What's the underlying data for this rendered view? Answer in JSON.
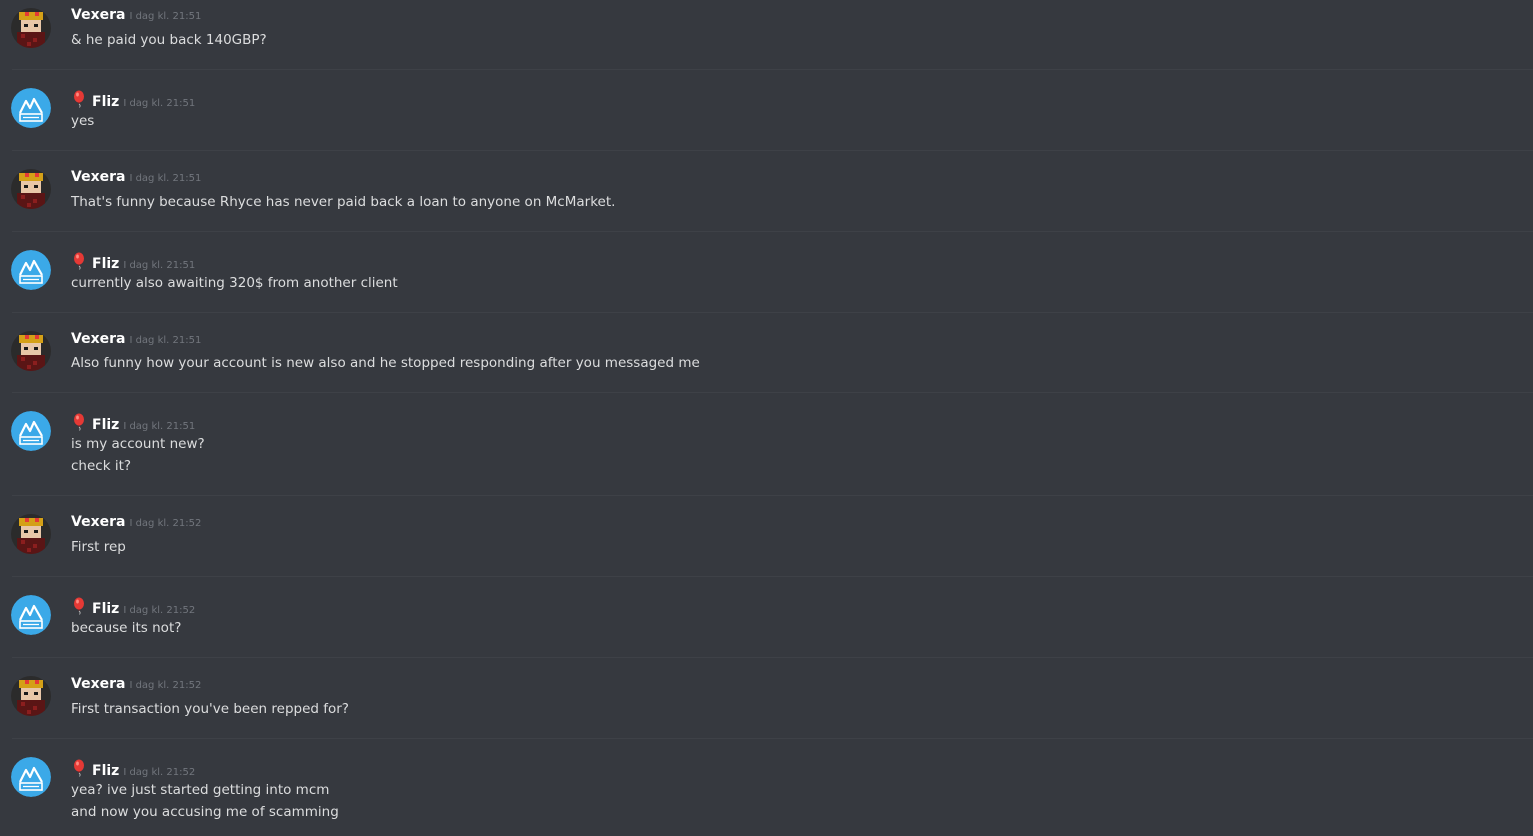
{
  "users": {
    "vexera": {
      "name": "Vexera",
      "avatar_icon": "pixel-character-avatar",
      "color": "#ffffff"
    },
    "fliz": {
      "name": "Fliz",
      "avatar_icon": "mountain-logo-avatar",
      "role_icon": "balloon-icon",
      "color": "#ffffff"
    }
  },
  "colors": {
    "background": "#36393f",
    "message_text": "#dcddde",
    "timestamp": "#72767d",
    "fliz_avatar_bg": "#3ba9e8",
    "balloon": "#e53935"
  },
  "messages": [
    {
      "user": "Vexera",
      "time": "I dag kl. 21:51",
      "lines": [
        "& he paid you back 140GBP?"
      ]
    },
    {
      "user": "Fliz",
      "time": "I dag kl. 21:51",
      "lines": [
        "yes"
      ]
    },
    {
      "user": "Vexera",
      "time": "I dag kl. 21:51",
      "lines": [
        "That's funny because Rhyce has never paid back a loan to anyone on McMarket."
      ]
    },
    {
      "user": "Fliz",
      "time": "I dag kl. 21:51",
      "lines": [
        "currently also awaiting 320$ from another client"
      ]
    },
    {
      "user": "Vexera",
      "time": "I dag kl. 21:51",
      "lines": [
        "Also funny how your account is new also and he stopped responding after you messaged me"
      ]
    },
    {
      "user": "Fliz",
      "time": "I dag kl. 21:51",
      "lines": [
        "is my account new?",
        "check it?"
      ]
    },
    {
      "user": "Vexera",
      "time": "I dag kl. 21:52",
      "lines": [
        "First rep"
      ]
    },
    {
      "user": "Fliz",
      "time": "I dag kl. 21:52",
      "lines": [
        "because its not?"
      ]
    },
    {
      "user": "Vexera",
      "time": "I dag kl. 21:52",
      "lines": [
        "First transaction you've been repped for?"
      ]
    },
    {
      "user": "Fliz",
      "time": "I dag kl. 21:52",
      "lines": [
        "yea? ive just started getting into mcm",
        "and now you accusing me of scamming"
      ]
    }
  ]
}
